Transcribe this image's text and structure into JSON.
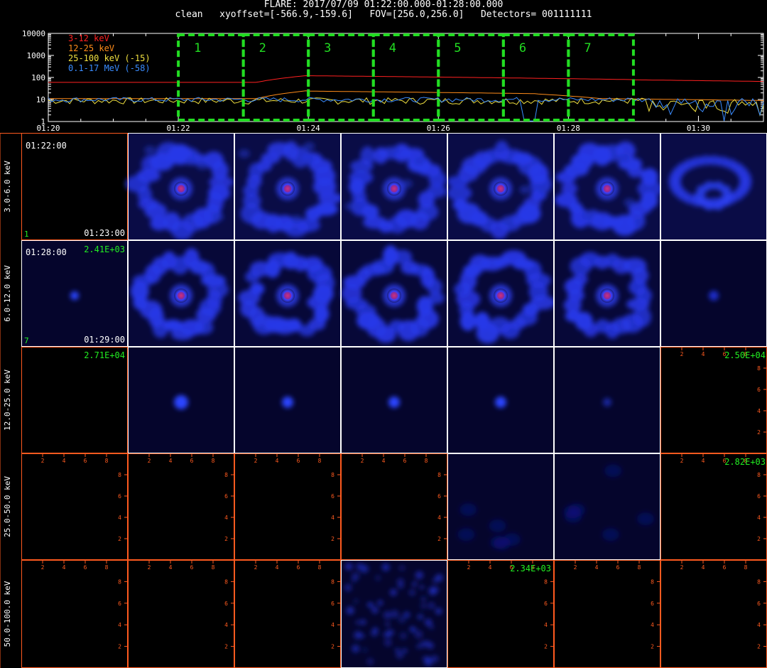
{
  "header": {
    "title": "FLARE: 2017/07/09 01:22:00.000-01:28:00.000",
    "params": "clean   xyoffset=[-566.9,-159.6]   FOV=[256.0,256.0]   Detectors= 001111111"
  },
  "lightcurve": {
    "y_ticks": [
      "10000",
      "1000",
      "100",
      "10",
      "1"
    ],
    "x_ticks": [
      "01:20",
      "01:22",
      "01:24",
      "01:26",
      "01:28",
      "01:30"
    ],
    "legend": [
      {
        "label": "3-12 keV",
        "color": "#ff2020"
      },
      {
        "label": "12-25 keV",
        "color": "#ff8c1a"
      },
      {
        "label": "25-100 keV (-15)",
        "color": "#f0e040"
      },
      {
        "label": "0.1-17 MeV (-58)",
        "color": "#3a8cff"
      }
    ],
    "intervals": [
      "1",
      "2",
      "3",
      "4",
      "5",
      "6",
      "7"
    ]
  },
  "energy_bands": [
    "3.0-6.0 keV",
    "6.0-12.0 keV",
    "12.0-25.0 keV",
    "25.0-50.0 keV",
    "50.0-100.0 keV"
  ],
  "panel_labels": {
    "row0_time_top": "01:22:00",
    "row0_time_bottom": "01:23:00",
    "row0_index": "1",
    "row1_time_top": "01:28:00",
    "row1_time_bottom": "01:29:00",
    "row1_index": "7",
    "row1_peak": "2.41E+03",
    "row2_peak_left": "2.71E+04",
    "row2_peak_right": "2.50E+04",
    "row3_peak_right": "2.82E+03",
    "row4_peak": "2.34E+03"
  },
  "axis_ticks": [
    "2",
    "4",
    "6",
    "8"
  ],
  "colors": {
    "border_white": "#ffffff",
    "border_orange": "#ff5a1f",
    "label_green": "#22ee22",
    "interval_green": "#22dd22"
  }
}
